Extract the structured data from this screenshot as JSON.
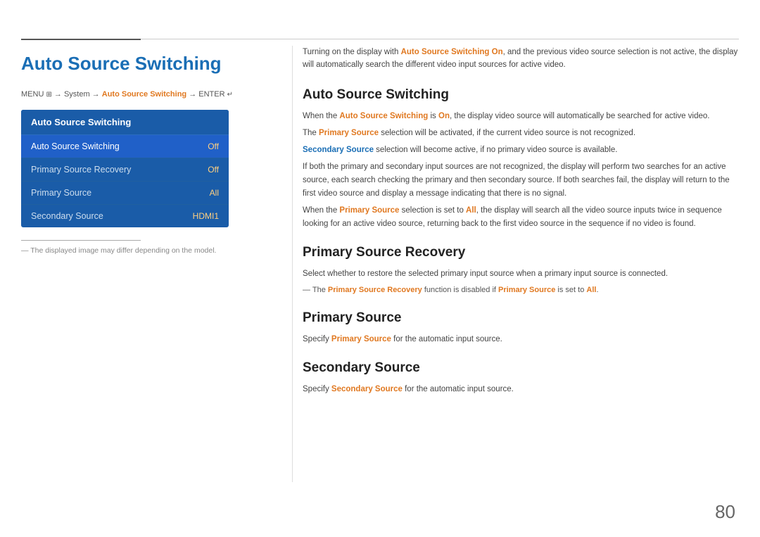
{
  "topBar": {},
  "leftCol": {
    "pageTitle": "Auto Source Switching",
    "breadcrumb": {
      "prefix": "MENU ",
      "menuIcon": "≡",
      "part1": " → System → ",
      "highlight": "Auto Source Switching",
      "part2": " → ENTER "
    },
    "menuPanel": {
      "header": "Auto Source Switching",
      "items": [
        {
          "label": "Auto Source Switching",
          "value": "Off",
          "active": true
        },
        {
          "label": "Primary Source Recovery",
          "value": "Off",
          "active": false
        },
        {
          "label": "Primary Source",
          "value": "All",
          "active": false
        },
        {
          "label": "Secondary Source",
          "value": "HDMI1",
          "active": false
        }
      ]
    },
    "footnote": "The displayed image may differ depending on the model."
  },
  "rightCol": {
    "introText": "Turning on the display with Auto Source Switching On, and the previous video source selection is not active, the display will automatically search the different video input sources for active video.",
    "sections": [
      {
        "id": "auto-source-switching",
        "title": "Auto Source Switching",
        "paragraphs": [
          "When the Auto Source Switching is On, the display video source will automatically be searched for active video.",
          "The Primary Source selection will be activated, if the current video source is not recognized.",
          "Secondary Source selection will become active, if no primary video source is available.",
          "If both the primary and secondary input sources are not recognized, the display will perform two searches for an active source, each search checking the primary and then secondary source. If both searches fail, the display will return to the first video source and display a message indicating that there is no signal.",
          "When the Primary Source selection is set to All, the display will search all the video source inputs twice in sequence looking for an active video source, returning back to the first video source in the sequence if no video is found."
        ]
      },
      {
        "id": "primary-source-recovery",
        "title": "Primary Source Recovery",
        "paragraphs": [
          "Select whether to restore the selected primary input source when a primary input source is connected."
        ],
        "note": "The Primary Source Recovery function is disabled if Primary Source is set to All."
      },
      {
        "id": "primary-source",
        "title": "Primary Source",
        "paragraphs": [
          "Specify Primary Source for the automatic input source."
        ]
      },
      {
        "id": "secondary-source",
        "title": "Secondary Source",
        "paragraphs": [
          "Specify Secondary Source for the automatic input source."
        ]
      }
    ]
  },
  "pageNumber": "80"
}
